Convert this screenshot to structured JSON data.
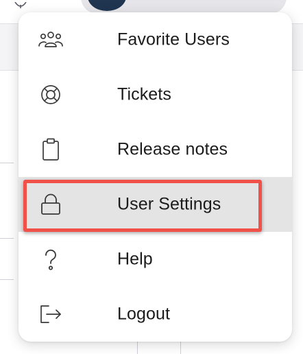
{
  "menu": {
    "items": [
      {
        "label": "Favorite Users",
        "icon": "users-group-icon",
        "selected": false
      },
      {
        "label": "Tickets",
        "icon": "lifebuoy-icon",
        "selected": false
      },
      {
        "label": "Release notes",
        "icon": "clipboard-icon",
        "selected": false
      },
      {
        "label": "User Settings",
        "icon": "lock-icon",
        "selected": true
      },
      {
        "label": "Help",
        "icon": "question-icon",
        "selected": false
      },
      {
        "label": "Logout",
        "icon": "logout-icon",
        "selected": false
      }
    ]
  },
  "colors": {
    "highlight": "#f0524a",
    "selected_background": "#e4e4e4",
    "avatar": "#1f3550"
  }
}
